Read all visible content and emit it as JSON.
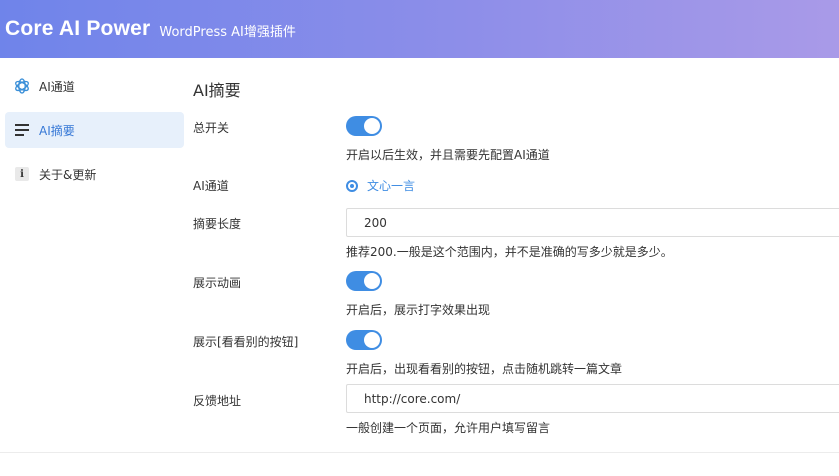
{
  "header": {
    "brand": "Core AI Power",
    "subtitle": "WordPress AI增强插件"
  },
  "sidebar": {
    "items": [
      {
        "label": "AI通道",
        "icon": "openai-icon",
        "active": false
      },
      {
        "label": "AI摘要",
        "icon": "lines-icon",
        "active": true
      },
      {
        "label": "关于&更新",
        "icon": "info-icon",
        "active": false
      }
    ]
  },
  "main": {
    "title": "AI摘要",
    "fields": {
      "master_switch": {
        "label": "总开关",
        "enabled": true,
        "hint": "开启以后生效，并且需要先配置AI通道"
      },
      "ai_channel": {
        "label": "AI通道",
        "selected": "文心一言"
      },
      "summary_length": {
        "label": "摘要长度",
        "value": "200",
        "hint": "推荐200.一般是这个范围内，并不是准确的写多少就是多少。"
      },
      "show_animation": {
        "label": "展示动画",
        "enabled": true,
        "hint": "开启后，展示打字效果出现"
      },
      "show_other_button": {
        "label": "展示[看看别的按钮]",
        "enabled": true,
        "hint": "开启后，出现看看别的按钮，点击随机跳转一篇文章"
      },
      "feedback_url": {
        "label": "反馈地址",
        "value": "http://core.com/",
        "hint": "一般创建一个页面，允许用户填写留言"
      }
    }
  },
  "colors": {
    "accent": "#3f8de3",
    "header_gradient_start": "#6f84ea",
    "header_gradient_end": "#a99ae8",
    "active_nav_bg": "#e7f0fb"
  }
}
